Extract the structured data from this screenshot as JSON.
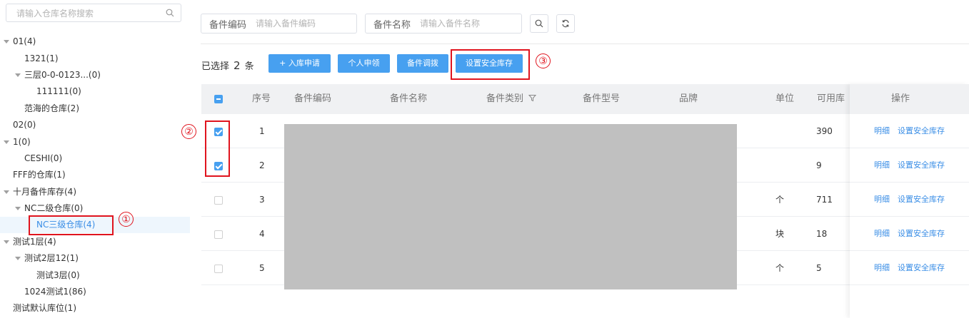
{
  "tree": {
    "search_placeholder": "请输入仓库名称搜索",
    "nodes": [
      "01(4)",
      "1321(1)",
      "三层0-0-0123...(0)",
      "111111(0)",
      "范海的仓库(2)",
      "02(0)",
      "1(0)",
      "CESHI(0)",
      "FFF的仓库(1)",
      "十月备件库存(4)",
      "NC二级仓库(0)",
      "NC三级仓库(4)",
      "测试1层(4)",
      "测试2层12(1)",
      "测试3层(0)",
      "1024测试1(86)",
      "测试默认库位(1)"
    ],
    "selected_index": 11
  },
  "filters": {
    "code_label": "备件编码",
    "code_placeholder": "请输入备件编码",
    "name_label": "备件名称",
    "name_placeholder": "请输入备件名称",
    "search_icon": "search-icon",
    "reset_icon": "refresh-icon"
  },
  "toolbar": {
    "selected_prefix": "已选择",
    "selected_count": "2",
    "selected_suffix": "条",
    "btn_inbound": "+ 入库申请",
    "btn_personal": "个人申领",
    "btn_transfer": "备件调拨",
    "btn_safety": "设置安全库存"
  },
  "table": {
    "headers": [
      "序号",
      "备件编码",
      "备件名称",
      "备件类别",
      "备件型号",
      "品牌",
      "单位",
      "可用库",
      "操作"
    ],
    "rows": [
      {
        "no": "1",
        "unit": "",
        "available": "390",
        "checked": true
      },
      {
        "no": "2",
        "unit": "",
        "available": "9",
        "checked": true
      },
      {
        "no": "3",
        "unit": "个",
        "available": "711",
        "checked": false
      },
      {
        "no": "4",
        "unit": "块",
        "available": "18",
        "checked": false
      },
      {
        "no": "5",
        "unit": "个",
        "available": "5",
        "checked": false
      }
    ],
    "action_detail": "明细",
    "action_safety": "设置安全库存"
  },
  "annotations": [
    "①",
    "②",
    "③"
  ],
  "colors": {
    "primary": "#47a0f0",
    "link": "#3a8ee6",
    "annotation": "#e0141e",
    "redaction": "#c0c0c0"
  }
}
